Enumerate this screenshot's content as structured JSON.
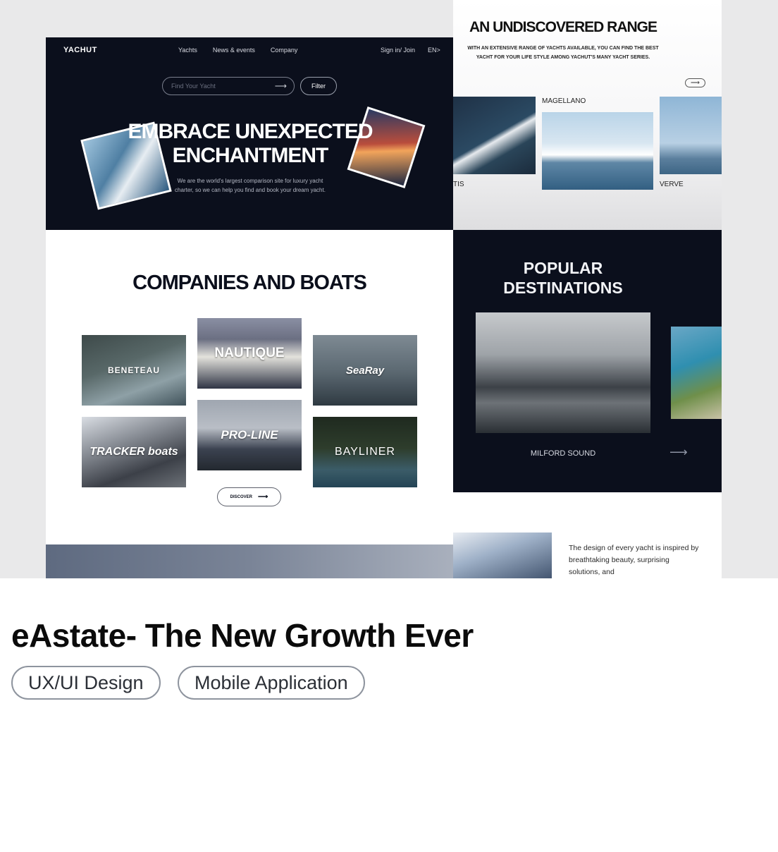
{
  "preview": {
    "left": {
      "nav": {
        "logo": "YACHUT",
        "links": [
          "Yachts",
          "News & events",
          "Company"
        ],
        "signin": "Sign in/ Join",
        "lang": "EN>"
      },
      "search": {
        "placeholder": "Find Your Yacht",
        "filter": "Filter"
      },
      "headline_line1": "EMBRACE UNEXPECTED",
      "headline_line2": "ENCHANTMENT",
      "subtext": "We are the world's largest comparison site for luxury yacht charter, so we can help you find and book your dream yacht.",
      "companies_title": "COMPANIES AND BOATS",
      "brands": [
        "BENETEAU",
        "NAUTIQUE",
        "SeaRay",
        "TRACKER boats",
        "PRO-LINE",
        "BAYLINER"
      ],
      "discover": "DISCOVER"
    },
    "right": {
      "range_title": "AN UNDISCOVERED RANGE",
      "range_subtitle": "WITH AN EXTENSIVE RANGE OF YACHTS AVAILABLE, YOU CAN FIND THE BEST YACHT FOR YOUR LIFE STYLE AMONG YACHUT'S MANY YACHT SERIES.",
      "yachts": [
        "TIS",
        "MAGELLANO",
        "VERVE"
      ],
      "destinations_title_1": "POPULAR",
      "destinations_title_2": "DESTINATIONS",
      "destination_name": "MILFORD SOUND",
      "design_text": "The design of every yacht is inspired by breathtaking beauty, surprising solutions, and"
    }
  },
  "card": {
    "title": "eAstate- The New Growth Ever",
    "tags": [
      "UX/UI Design",
      "Mobile Application"
    ]
  }
}
